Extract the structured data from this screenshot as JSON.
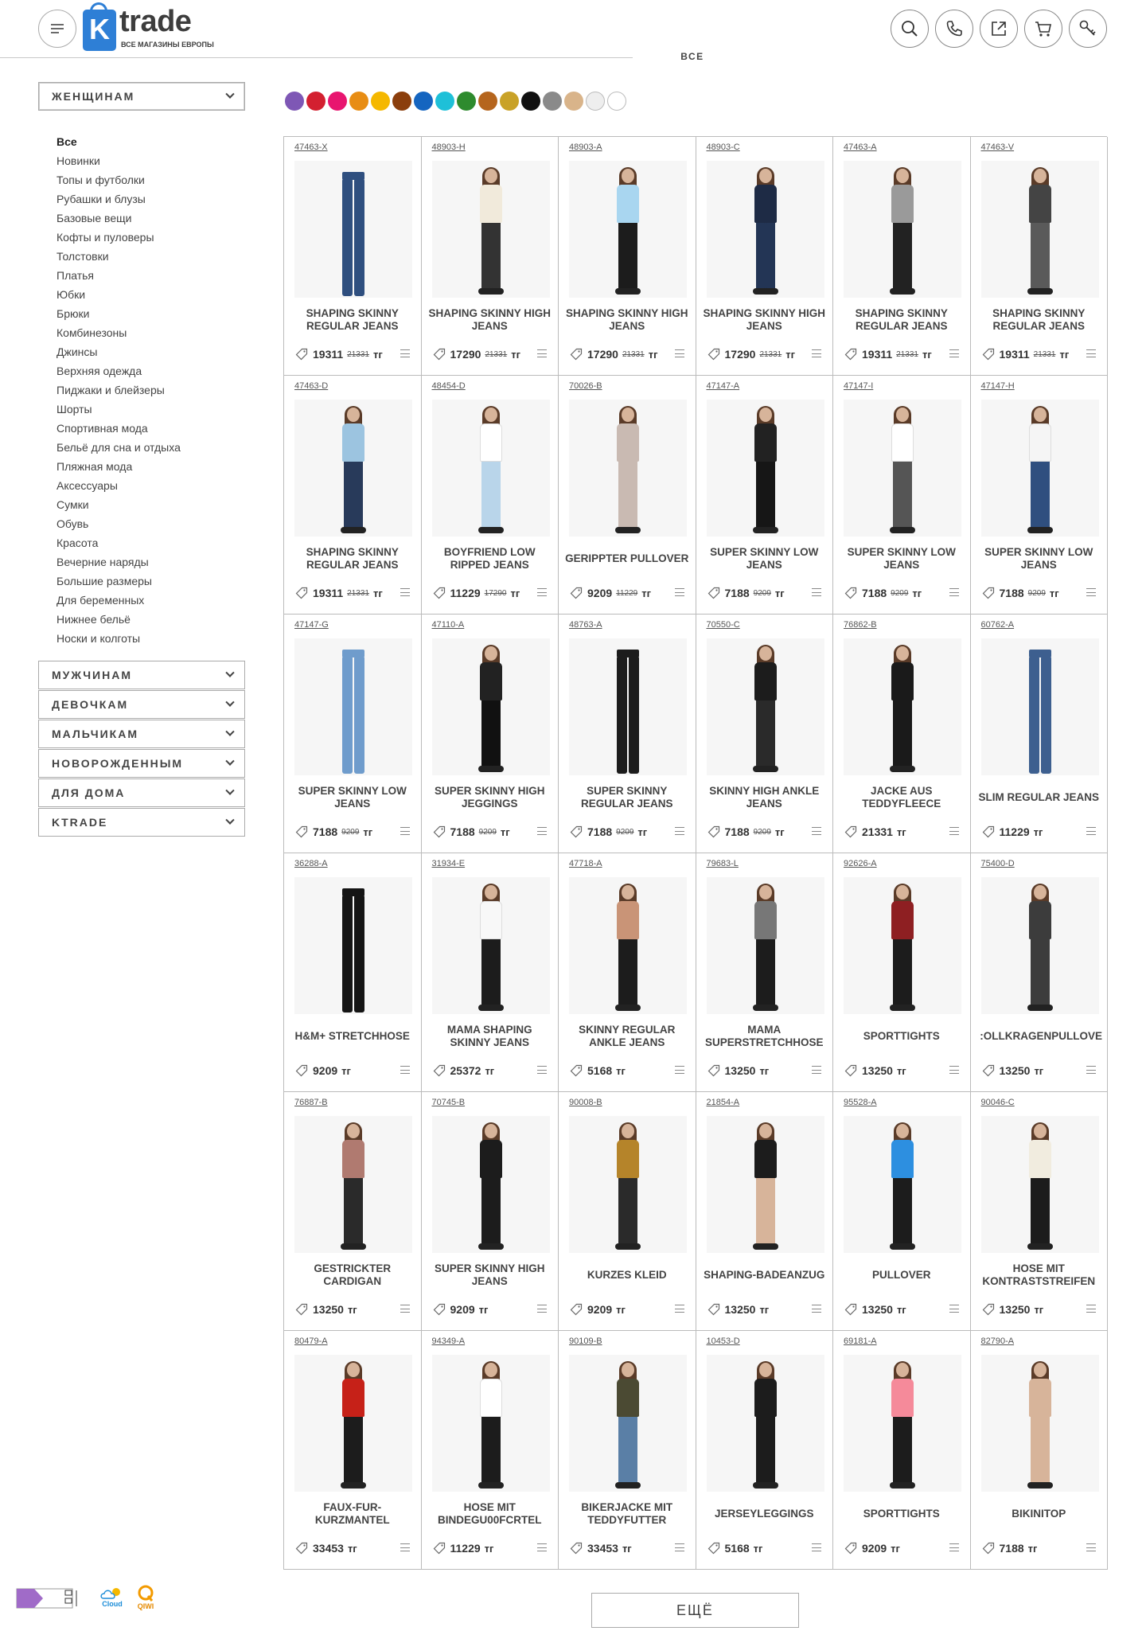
{
  "header": {
    "logo_main": "trade",
    "logo_letter": "K",
    "logo_sub": "ВСЕ МАГАЗИНЫ ЕВРОПЫ",
    "all_tab": "ВСЕ",
    "icons": [
      "search-icon",
      "phone-icon",
      "external-link-icon",
      "cart-icon",
      "key-icon"
    ]
  },
  "sidebar": {
    "open_category": "ЖЕНЩИНАМ",
    "subcategories": [
      "Все",
      "Новинки",
      "Топы и футболки",
      "Рубашки и блузы",
      "Базовые вещи",
      "Кофты и пуловеры",
      "Толстовки",
      "Платья",
      "Юбки",
      "Брюки",
      "Комбинезоны",
      "Джинсы",
      "Верхняя одежда",
      "Пиджаки и блейзеры",
      "Шорты",
      "Спортивная мода",
      "Бельё для сна и отдыха",
      "Пляжная мода",
      "Аксессуары",
      "Сумки",
      "Обувь",
      "Красота",
      "Вечерние наряды",
      "Большие размеры",
      "Для беременных",
      "Нижнее бельё",
      "Носки и колготы"
    ],
    "active_subcategory": "Все",
    "other_categories": [
      "МУЖЧИНАМ",
      "ДЕВОЧКАМ",
      "МАЛЬЧИКАМ",
      "НОВОРОЖДЕННЫМ",
      "ДЛЯ ДОМА",
      "KTRADE"
    ]
  },
  "colors": [
    "#7e57b5",
    "#d32030",
    "#e8156f",
    "#e88d14",
    "#f5b800",
    "#8b3e0c",
    "#1565c0",
    "#1ec0d8",
    "#2e8b2e",
    "#b5651d",
    "#c9a227",
    "#111111",
    "#8a8a8a",
    "#d9b48a",
    "#eeeeee",
    "#ffffff"
  ],
  "currency": "тг",
  "products": [
    {
      "sku": "47463-X",
      "name": "SHAPING SKINNY REGULAR JEANS",
      "price": "19311",
      "old": "21331"
    },
    {
      "sku": "48903-H",
      "name": "SHAPING SKINNY HIGH JEANS",
      "price": "17290",
      "old": "21331"
    },
    {
      "sku": "48903-A",
      "name": "SHAPING SKINNY HIGH JEANS",
      "price": "17290",
      "old": "21331"
    },
    {
      "sku": "48903-C",
      "name": "SHAPING SKINNY HIGH JEANS",
      "price": "17290",
      "old": "21331"
    },
    {
      "sku": "47463-A",
      "name": "SHAPING SKINNY REGULAR JEANS",
      "price": "19311",
      "old": "21331"
    },
    {
      "sku": "47463-V",
      "name": "SHAPING SKINNY REGULAR JEANS",
      "price": "19311",
      "old": "21331"
    },
    {
      "sku": "47463-D",
      "name": "SHAPING SKINNY REGULAR JEANS",
      "price": "19311",
      "old": "21331"
    },
    {
      "sku": "48454-D",
      "name": "BOYFRIEND LOW RIPPED JEANS",
      "price": "11229",
      "old": "17290"
    },
    {
      "sku": "70026-B",
      "name": "GERIPPTER PULLOVER",
      "price": "9209",
      "old": "11229"
    },
    {
      "sku": "47147-A",
      "name": "SUPER SKINNY LOW JEANS",
      "price": "7188",
      "old": "9209"
    },
    {
      "sku": "47147-I",
      "name": "SUPER SKINNY LOW JEANS",
      "price": "7188",
      "old": "9209"
    },
    {
      "sku": "47147-H",
      "name": "SUPER SKINNY LOW JEANS",
      "price": "7188",
      "old": "9209"
    },
    {
      "sku": "47147-G",
      "name": "SUPER SKINNY LOW JEANS",
      "price": "7188",
      "old": "9209"
    },
    {
      "sku": "47110-A",
      "name": "SUPER SKINNY HIGH JEGGINGS",
      "price": "7188",
      "old": "9209"
    },
    {
      "sku": "48763-A",
      "name": "SUPER SKINNY REGULAR JEANS",
      "price": "7188",
      "old": "9209"
    },
    {
      "sku": "70550-C",
      "name": "SKINNY HIGH ANKLE JEANS",
      "price": "7188",
      "old": "9209"
    },
    {
      "sku": "76862-B",
      "name": "JACKE AUS TEDDYFLEECE",
      "price": "21331",
      "old": ""
    },
    {
      "sku": "60762-A",
      "name": "SLIM REGULAR JEANS",
      "price": "11229",
      "old": ""
    },
    {
      "sku": "36288-A",
      "name": "H&M+ STRETCHHOSE",
      "price": "9209",
      "old": ""
    },
    {
      "sku": "31934-E",
      "name": "MAMA SHAPING SKINNY JEANS",
      "price": "25372",
      "old": ""
    },
    {
      "sku": "47718-A",
      "name": "SKINNY REGULAR ANKLE JEANS",
      "price": "5168",
      "old": ""
    },
    {
      "sku": "79683-L",
      "name": "MAMA SUPERSTRETCHHOSE",
      "price": "13250",
      "old": ""
    },
    {
      "sku": "92626-A",
      "name": "SPORTTIGHTS",
      "price": "13250",
      "old": ""
    },
    {
      "sku": "75400-D",
      "name": ":OLLKRAGENPULLOVE",
      "price": "13250",
      "old": ""
    },
    {
      "sku": "76887-B",
      "name": "GESTRICKTER CARDIGAN",
      "price": "13250",
      "old": ""
    },
    {
      "sku": "70745-B",
      "name": "SUPER SKINNY HIGH JEANS",
      "price": "9209",
      "old": ""
    },
    {
      "sku": "90008-B",
      "name": "KURZES KLEID",
      "price": "9209",
      "old": ""
    },
    {
      "sku": "21854-A",
      "name": "SHAPING-BADEANZUG",
      "price": "13250",
      "old": ""
    },
    {
      "sku": "95528-A",
      "name": "PULLOVER",
      "price": "13250",
      "old": ""
    },
    {
      "sku": "90046-C",
      "name": "HOSE MIT KONTRASTSTREIFEN",
      "price": "13250",
      "old": ""
    },
    {
      "sku": "80479-A",
      "name": "FAUX-FUR-KURZMANTEL",
      "price": "33453",
      "old": ""
    },
    {
      "sku": "94349-A",
      "name": "HOSE MIT BINDEGU00FCRTEL",
      "price": "11229",
      "old": ""
    },
    {
      "sku": "90109-B",
      "name": "BIKERJACKE MIT TEDDYFUTTER",
      "price": "33453",
      "old": ""
    },
    {
      "sku": "10453-D",
      "name": "JERSEYLEGGINGS",
      "price": "5168",
      "old": ""
    },
    {
      "sku": "69181-A",
      "name": "SPORTTIGHTS",
      "price": "9209",
      "old": ""
    },
    {
      "sku": "82790-A",
      "name": "BIKINITOP",
      "price": "7188",
      "old": ""
    }
  ],
  "more_button": "ЕЩЁ",
  "payment": {
    "cloud": "Cloud",
    "qiwi": "QIWI"
  }
}
